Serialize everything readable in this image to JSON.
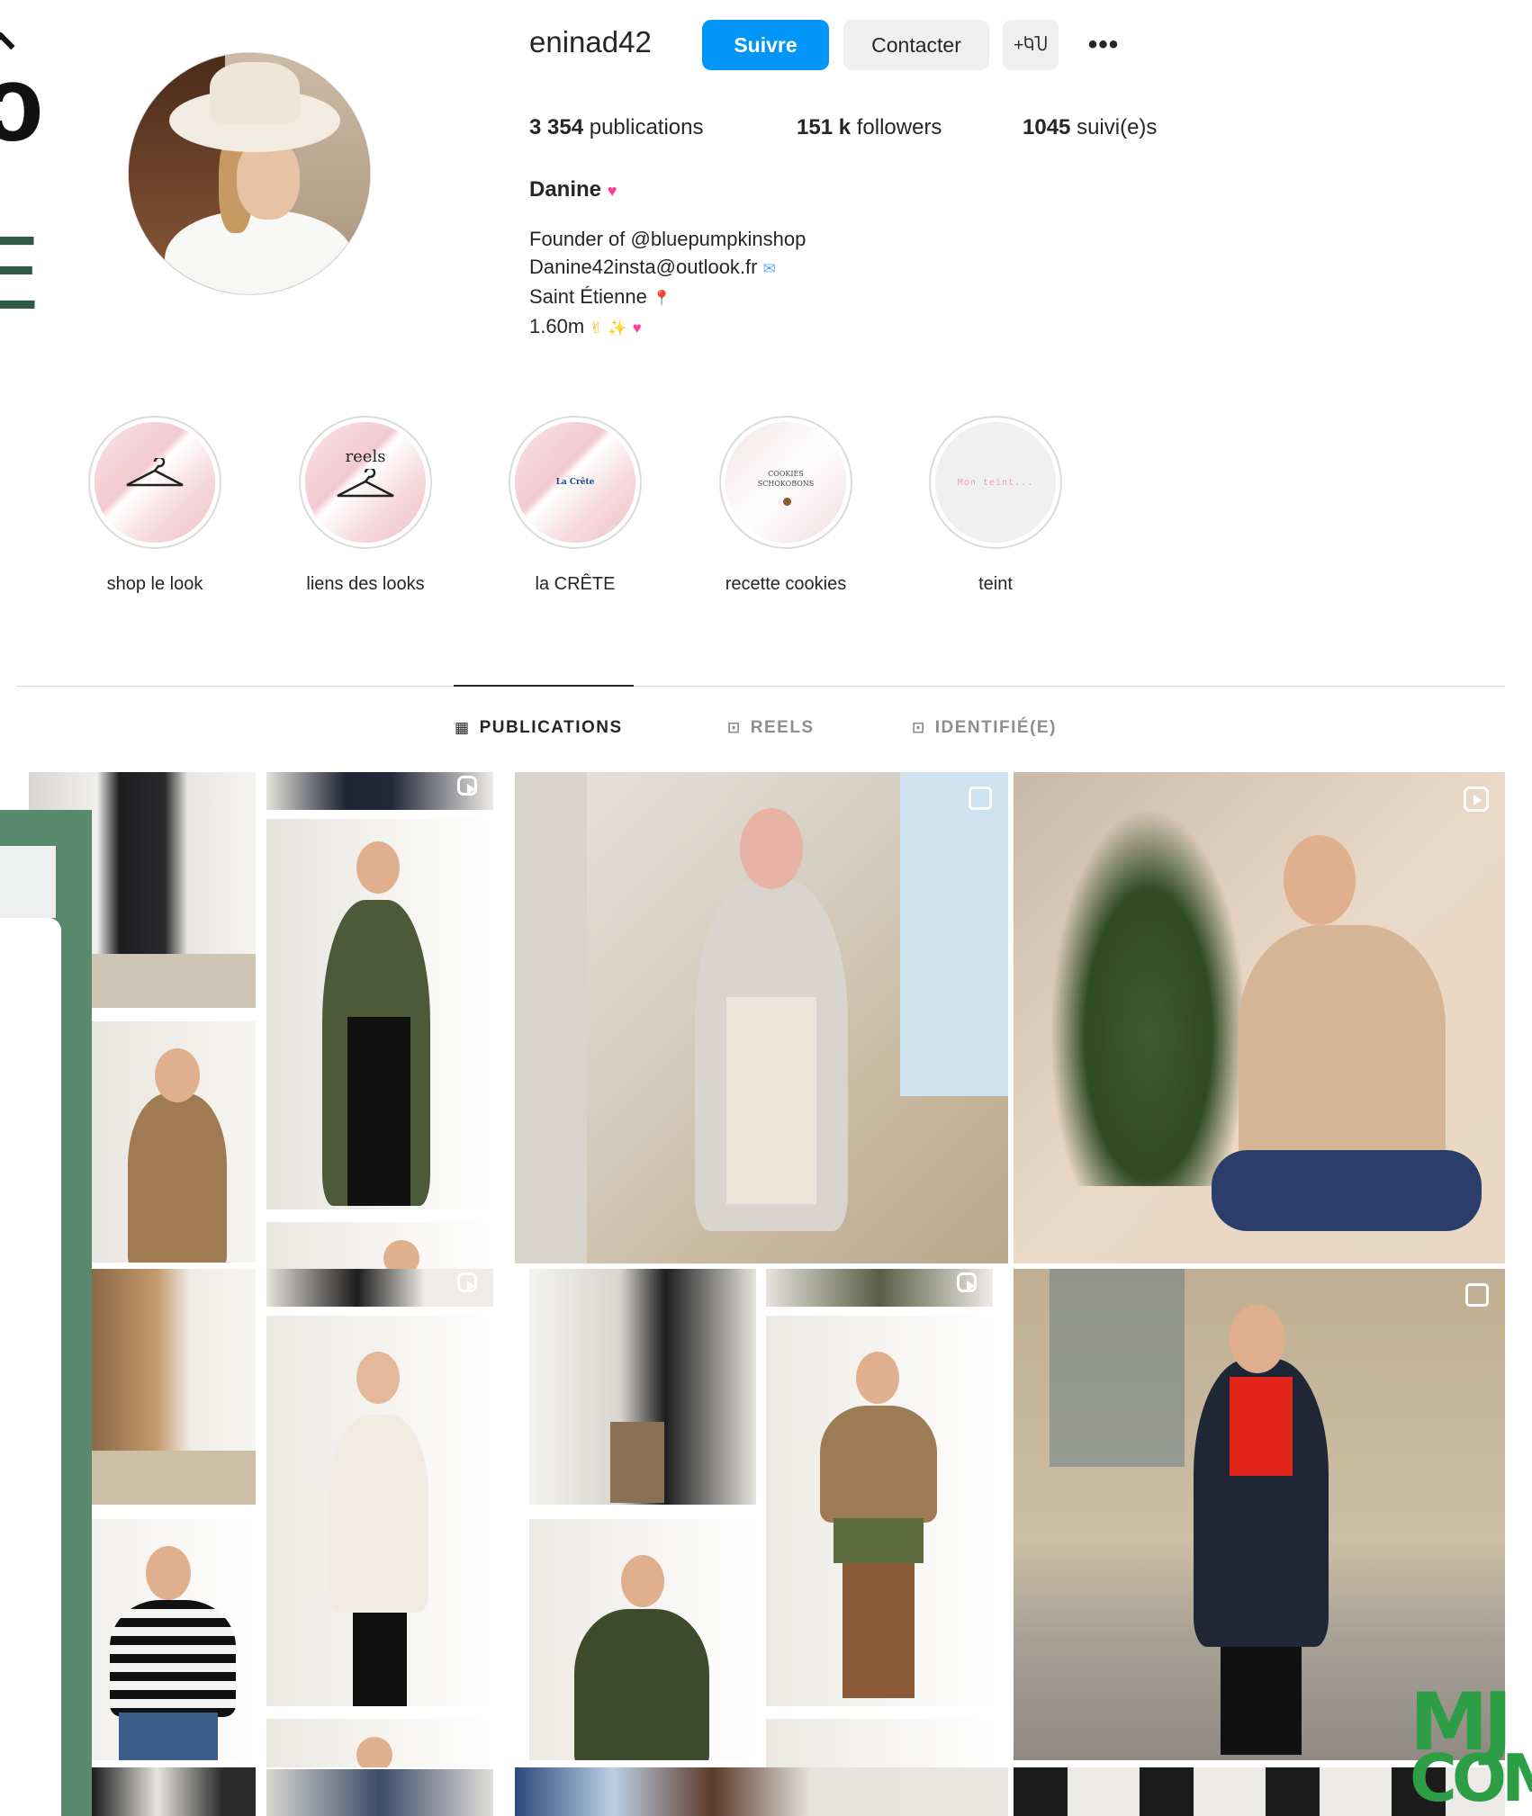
{
  "profile": {
    "username": "eninad42",
    "follow_label": "Suivre",
    "contact_label": "Contacter",
    "add_user_icon": "+ႩႮ",
    "more_label": "•••",
    "stats": {
      "publications_count": "3 354",
      "publications_label": "publications",
      "followers_count": "151 k",
      "followers_label": "followers",
      "following_count": "1045",
      "following_label": "suivi(e)s"
    },
    "full_name": "Danine",
    "bio": [
      "Founder of @bluepumpkinshop",
      "Danine42insta@outlook.fr",
      "Saint Étienne",
      "1.60m"
    ]
  },
  "highlights": [
    {
      "label": "shop le look"
    },
    {
      "label": "liens des looks",
      "cover_text": "reels"
    },
    {
      "label": "la CRÊTE",
      "cover_text": "La Crête"
    },
    {
      "label": "recette cookies",
      "cover_text": "COOKIES SCHOKOBONS"
    },
    {
      "label": "teint",
      "cover_text": "Mon teint..."
    }
  ],
  "tabs": [
    {
      "label": "PUBLICATIONS",
      "icon": "grid-icon",
      "active": true
    },
    {
      "label": "REELS",
      "icon": "reels-icon",
      "active": false
    },
    {
      "label": "IDENTIFIÉ(E)",
      "icon": "tagged-icon",
      "active": false
    }
  ],
  "overlay": {
    "logo_mj": "MJ",
    "logo_com": "COM"
  },
  "colors": {
    "follow_button": "#0095f6",
    "secondary_button": "#efefef",
    "green_panel": "#5a8a6e",
    "logo_green": "#2e9e46"
  }
}
